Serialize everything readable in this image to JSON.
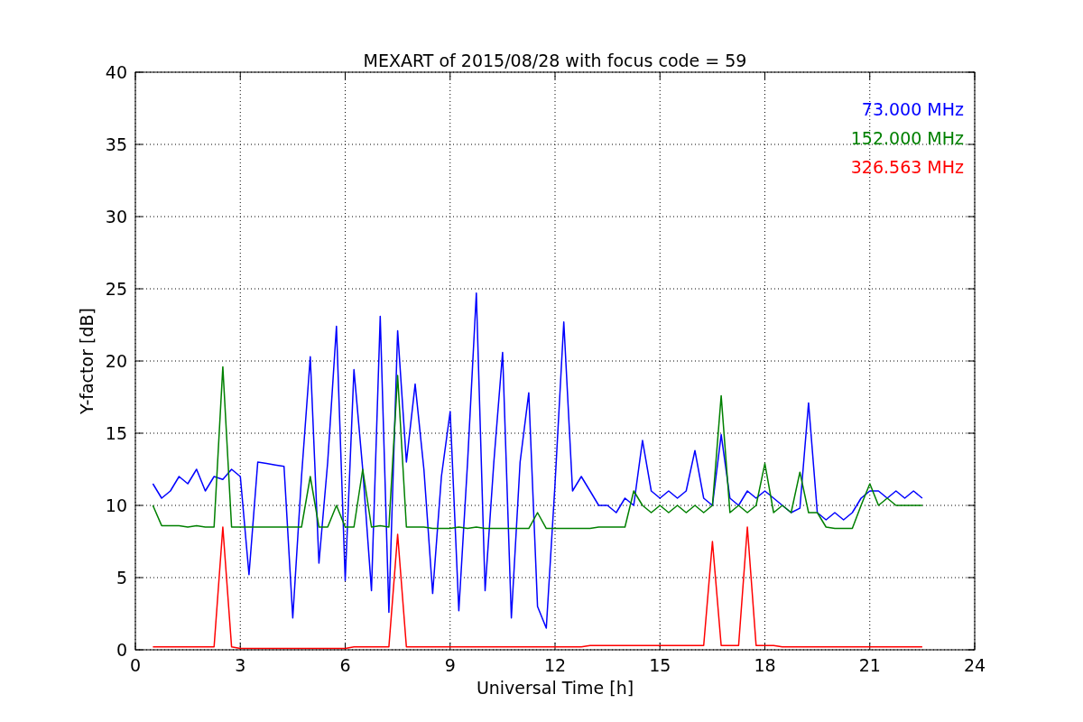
{
  "figure": {
    "chart_data": {
      "type": "line",
      "title": "MEXART of 2015/08/28 with focus code = 59",
      "xlabel": "Universal Time [h]",
      "ylabel": "Y-factor [dB]",
      "xlim": [
        0,
        24
      ],
      "ylim": [
        0,
        40
      ],
      "xticks": [
        0,
        3,
        6,
        9,
        12,
        15,
        18,
        21,
        24
      ],
      "yticks": [
        0,
        5,
        10,
        15,
        20,
        25,
        30,
        35,
        40
      ],
      "grid": true,
      "x": [
        0.5,
        0.75,
        1,
        1.25,
        1.5,
        1.75,
        2,
        2.25,
        2.5,
        2.75,
        3,
        3.25,
        3.5,
        3.75,
        4,
        4.25,
        4.5,
        4.75,
        5,
        5.25,
        5.5,
        5.75,
        6,
        6.25,
        6.5,
        6.75,
        7,
        7.25,
        7.5,
        7.75,
        8,
        8.25,
        8.5,
        8.75,
        9,
        9.25,
        9.5,
        9.75,
        10,
        10.25,
        10.5,
        10.75,
        11,
        11.25,
        11.5,
        11.75,
        12,
        12.25,
        12.5,
        12.75,
        13,
        13.25,
        13.5,
        13.75,
        14,
        14.25,
        14.5,
        14.75,
        15,
        15.25,
        15.5,
        15.75,
        16,
        16.25,
        16.5,
        16.75,
        17,
        17.25,
        17.5,
        17.75,
        18,
        18.25,
        18.5,
        18.75,
        19,
        19.25,
        19.5,
        19.75,
        20,
        20.25,
        20.5,
        20.75,
        21,
        21.25,
        21.5,
        21.75,
        22,
        22.25,
        22.5
      ],
      "series": [
        {
          "name": "73.000 MHz",
          "color": "#0000ff",
          "values": [
            11.5,
            10.5,
            11,
            12,
            11.5,
            12.5,
            11,
            12,
            11.8,
            12.5,
            12,
            5.2,
            13,
            12.9,
            12.8,
            12.7,
            2.2,
            12,
            20.3,
            6,
            13,
            22.4,
            4.8,
            19.4,
            12.5,
            4.1,
            23.1,
            2.6,
            22.1,
            13,
            18.4,
            12.5,
            3.9,
            12,
            16.5,
            2.7,
            13,
            24.7,
            4.1,
            13,
            20.6,
            2.2,
            13,
            17.8,
            3,
            1.5,
            11.5,
            22.7,
            11,
            12,
            11,
            10,
            10,
            9.5,
            10.5,
            10,
            14.5,
            11,
            10.5,
            11,
            10.5,
            11,
            13.8,
            10.5,
            10,
            14.9,
            10.5,
            10,
            11,
            10.5,
            11,
            10.5,
            10,
            9.5,
            9.8,
            17.1,
            9.5,
            9,
            9.5,
            9,
            9.5,
            10.5,
            11,
            11,
            10.5,
            11,
            10.5,
            11,
            10.5
          ]
        },
        {
          "name": "152.000 MHz",
          "color": "#008000",
          "values": [
            10,
            8.6,
            8.6,
            8.6,
            8.5,
            8.6,
            8.5,
            8.5,
            19.6,
            8.5,
            8.5,
            8.5,
            8.5,
            8.5,
            8.5,
            8.5,
            8.5,
            8.5,
            12,
            8.5,
            8.5,
            10,
            8.5,
            8.5,
            12.5,
            8.5,
            8.6,
            8.5,
            19,
            8.5,
            8.5,
            8.5,
            8.4,
            8.4,
            8.4,
            8.5,
            8.4,
            8.5,
            8.4,
            8.4,
            8.4,
            8.4,
            8.4,
            8.4,
            9.5,
            8.4,
            8.4,
            8.4,
            8.4,
            8.4,
            8.4,
            8.5,
            8.5,
            8.5,
            8.5,
            11,
            10,
            9.5,
            10,
            9.5,
            10,
            9.5,
            10,
            9.5,
            10,
            17.6,
            9.5,
            10,
            9.5,
            10,
            12.9,
            9.5,
            10,
            9.5,
            12.3,
            9.5,
            9.5,
            8.5,
            8.4,
            8.4,
            8.4,
            10,
            11.5,
            10,
            10.5,
            10,
            10,
            10,
            10
          ]
        },
        {
          "name": "326.563 MHz",
          "color": "#ff0000",
          "values": [
            0.2,
            0.2,
            0.2,
            0.2,
            0.2,
            0.2,
            0.2,
            0.2,
            8.5,
            0.2,
            0.1,
            0.1,
            0.1,
            0.1,
            0.1,
            0.1,
            0.1,
            0.1,
            0.1,
            0.1,
            0.1,
            0.1,
            0.1,
            0.2,
            0.2,
            0.2,
            0.2,
            0.2,
            8,
            0.2,
            0.2,
            0.2,
            0.2,
            0.2,
            0.2,
            0.2,
            0.2,
            0.2,
            0.2,
            0.2,
            0.2,
            0.2,
            0.2,
            0.2,
            0.2,
            0.2,
            0.2,
            0.2,
            0.2,
            0.2,
            0.3,
            0.3,
            0.3,
            0.3,
            0.3,
            0.3,
            0.3,
            0.3,
            0.3,
            0.3,
            0.3,
            0.3,
            0.3,
            0.3,
            7.5,
            0.3,
            0.3,
            0.3,
            8.5,
            0.3,
            0.3,
            0.3,
            0.2,
            0.2,
            0.2,
            0.2,
            0.2,
            0.2,
            0.2,
            0.2,
            0.2,
            0.2,
            0.2,
            0.2,
            0.2,
            0.2,
            0.2,
            0.2,
            0.2
          ]
        }
      ]
    }
  }
}
